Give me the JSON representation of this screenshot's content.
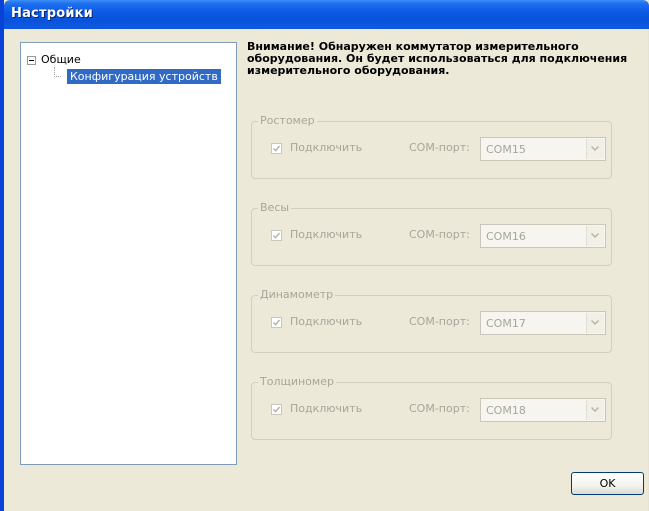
{
  "window": {
    "title": "Настройки"
  },
  "tree": {
    "root_label": "Общие",
    "child_label": "Конфигурация устройств"
  },
  "warning": {
    "text": "Внимание! Обнаружен коммутатор измерительного оборудования. Он будет использоваться для подключения измерительного оборудования."
  },
  "devices": [
    {
      "title": "Ростомер",
      "connect_label": "Подключить",
      "connect_checked": true,
      "port_label": "COM-порт:",
      "port_value": "COM15"
    },
    {
      "title": "Весы",
      "connect_label": "Подключить",
      "connect_checked": true,
      "port_label": "COM-порт:",
      "port_value": "COM16"
    },
    {
      "title": "Динамометр",
      "connect_label": "Подключить",
      "connect_checked": true,
      "port_label": "COM-порт:",
      "port_value": "COM17"
    },
    {
      "title": "Толщиномер",
      "connect_label": "Подключить",
      "connect_checked": true,
      "port_label": "COM-порт:",
      "port_value": "COM18"
    }
  ],
  "buttons": {
    "ok_label": "OK"
  },
  "colors": {
    "title_bar": "#0a58e4",
    "selection": "#316ac5",
    "disabled_text": "#a7a69b",
    "dialog_background": "#ece9d8"
  },
  "icons": {
    "expander": "tree-collapse-icon",
    "check": "checkmark-icon",
    "dropdown": "chevron-down-icon"
  }
}
